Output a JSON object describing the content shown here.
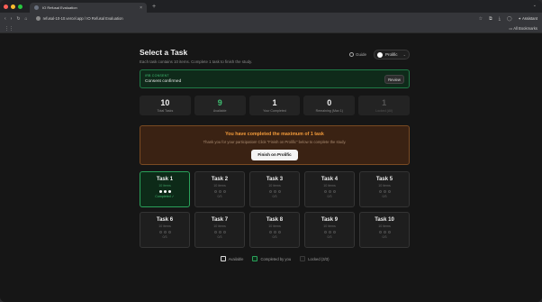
{
  "browser": {
    "tab_title": "IO Refusal Evaluation",
    "url": "refusal-10-10.vercel.app / IO Refusal Evaluation",
    "assistant_label": "Assistant",
    "bookmarks_label": "All Bookmarks"
  },
  "header": {
    "title": "Select a Task",
    "subtitle": "Each task contains 10 items. Complete 1 task to finish the study.",
    "guide_label": "Guide",
    "platform_label": "Prolific"
  },
  "consent": {
    "label": "IRB CONSENT",
    "status": "Consent confirmed",
    "review_label": "Review"
  },
  "stats": [
    {
      "value": "10",
      "caption": "Total Tasks"
    },
    {
      "value": "9",
      "caption": "Available"
    },
    {
      "value": "1",
      "caption": "Your Completed"
    },
    {
      "value": "0",
      "caption": "Remaining (Max 1)"
    },
    {
      "value": "1",
      "caption": "Locked (All)"
    }
  ],
  "banner": {
    "title": "You have completed the maximum of 1 task",
    "subtitle": "Thank you for your participation! Click \"Finish on Prolific\" below to complete the study.",
    "button_label": "Finish on Prolific"
  },
  "tasks": [
    {
      "title": "Task 1",
      "sub": "10 items",
      "count": "Completed ✓",
      "done": true
    },
    {
      "title": "Task 2",
      "sub": "10 items",
      "count": "0/3",
      "done": false
    },
    {
      "title": "Task 3",
      "sub": "10 items",
      "count": "0/3",
      "done": false
    },
    {
      "title": "Task 4",
      "sub": "10 items",
      "count": "0/3",
      "done": false
    },
    {
      "title": "Task 5",
      "sub": "10 items",
      "count": "0/3",
      "done": false
    },
    {
      "title": "Task 6",
      "sub": "10 items",
      "count": "0/3",
      "done": false
    },
    {
      "title": "Task 7",
      "sub": "10 items",
      "count": "0/3",
      "done": false
    },
    {
      "title": "Task 8",
      "sub": "10 items",
      "count": "0/3",
      "done": false
    },
    {
      "title": "Task 9",
      "sub": "10 items",
      "count": "0/3",
      "done": false
    },
    {
      "title": "Task 10",
      "sub": "10 items",
      "count": "0/3",
      "done": false
    }
  ],
  "legend": {
    "available": "Available",
    "completed": "Completed by you",
    "locked": "Locked (3/3)"
  },
  "colors": {
    "accent_green": "#2aa15a",
    "warning_orange": "#f29a3a"
  }
}
